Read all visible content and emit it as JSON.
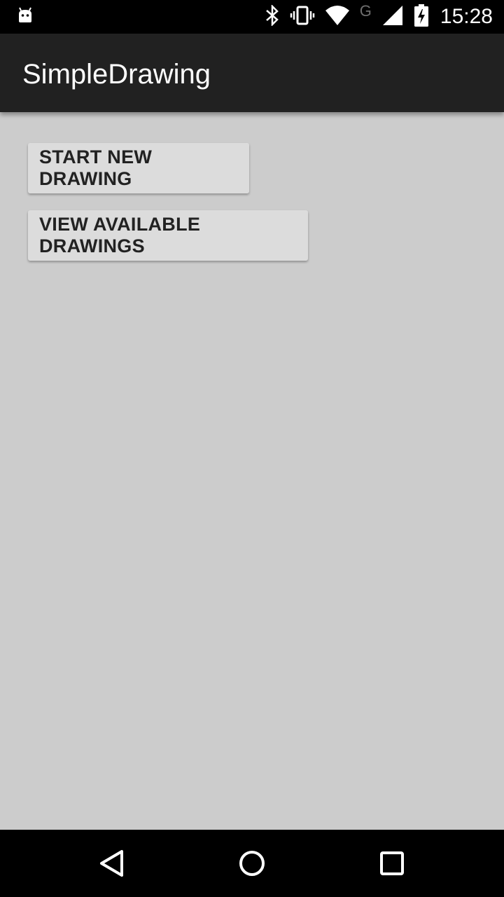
{
  "status_bar": {
    "time": "15:28",
    "network_letter": "G",
    "icons": [
      "android-icon",
      "bluetooth-icon",
      "vibrate-icon",
      "wifi-icon",
      "signal-icon",
      "battery-charging-icon"
    ]
  },
  "app_bar": {
    "title": "SimpleDrawing"
  },
  "main": {
    "buttons": [
      {
        "label": "START NEW DRAWING"
      },
      {
        "label": "VIEW AVAILABLE DRAWINGS"
      }
    ]
  },
  "nav_bar": {
    "icons": [
      "back-icon",
      "home-icon",
      "recent-apps-icon"
    ]
  },
  "colors": {
    "status_bar": "#000000",
    "app_bar": "#212121",
    "background": "#cccccc",
    "button": "#dcdcdc",
    "button_text": "#222222"
  }
}
